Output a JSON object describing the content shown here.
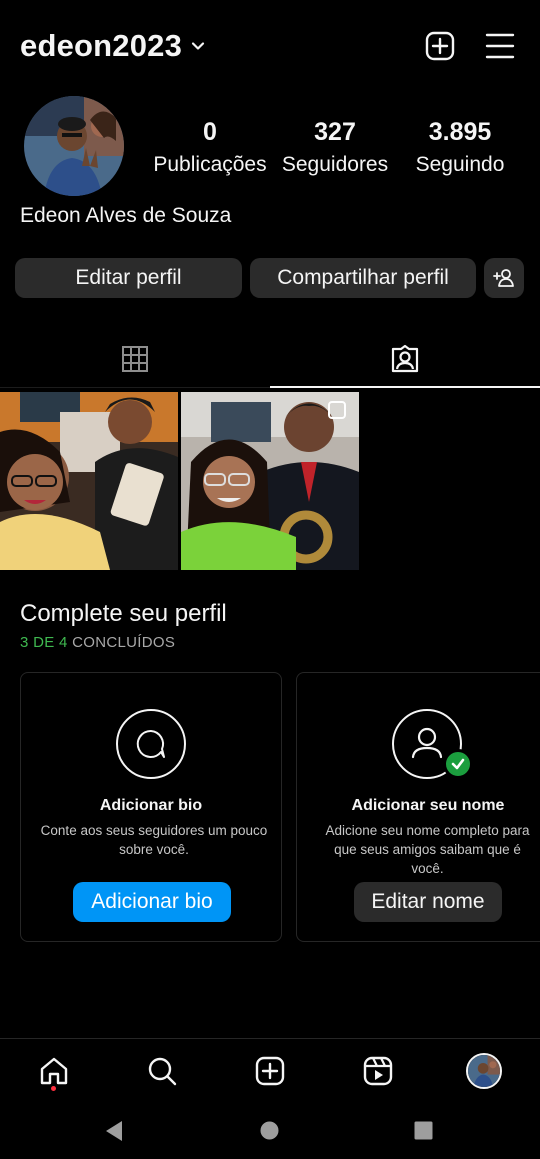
{
  "header": {
    "username": "edeon2023",
    "icons": [
      "chevron-down-icon",
      "add-post-icon",
      "hamburger-menu-icon"
    ]
  },
  "profile": {
    "full_name": "Edeon Alves de Souza",
    "stats": [
      {
        "value": "0",
        "label": "Publicações"
      },
      {
        "value": "327",
        "label": "Seguidores"
      },
      {
        "value": "3.895",
        "label": "Seguindo"
      }
    ]
  },
  "actions": {
    "edit_profile": "Editar perfil",
    "share_profile": "Compartilhar perfil",
    "discover_icon": "add-person-icon"
  },
  "tabs": [
    {
      "icon": "grid-icon",
      "active": false
    },
    {
      "icon": "tagged-icon",
      "active": true
    }
  ],
  "complete_profile": {
    "title": "Complete seu perfil",
    "progress": "3 DE 4",
    "progress_suffix": "CONCLUÍDOS",
    "cards": [
      {
        "icon": "speech-bubble-icon",
        "title": "Adicionar bio",
        "description": "Conte aos seus seguidores um pouco sobre você.",
        "button": "Adicionar bio",
        "completed": false
      },
      {
        "icon": "person-icon",
        "title": "Adicionar seu nome",
        "description": "Adicione seu nome completo para que seus amigos saibam que é você.",
        "button": "Editar nome",
        "completed": true
      }
    ]
  },
  "bottom_nav": [
    "home-icon",
    "search-icon",
    "create-icon",
    "reels-icon",
    "profile-avatar"
  ],
  "colors": {
    "background": "#000000",
    "button_bg": "#2b2b2b",
    "primary_blue": "#0095f6",
    "success_green": "#3fb950",
    "notification_red": "#ff3040"
  }
}
